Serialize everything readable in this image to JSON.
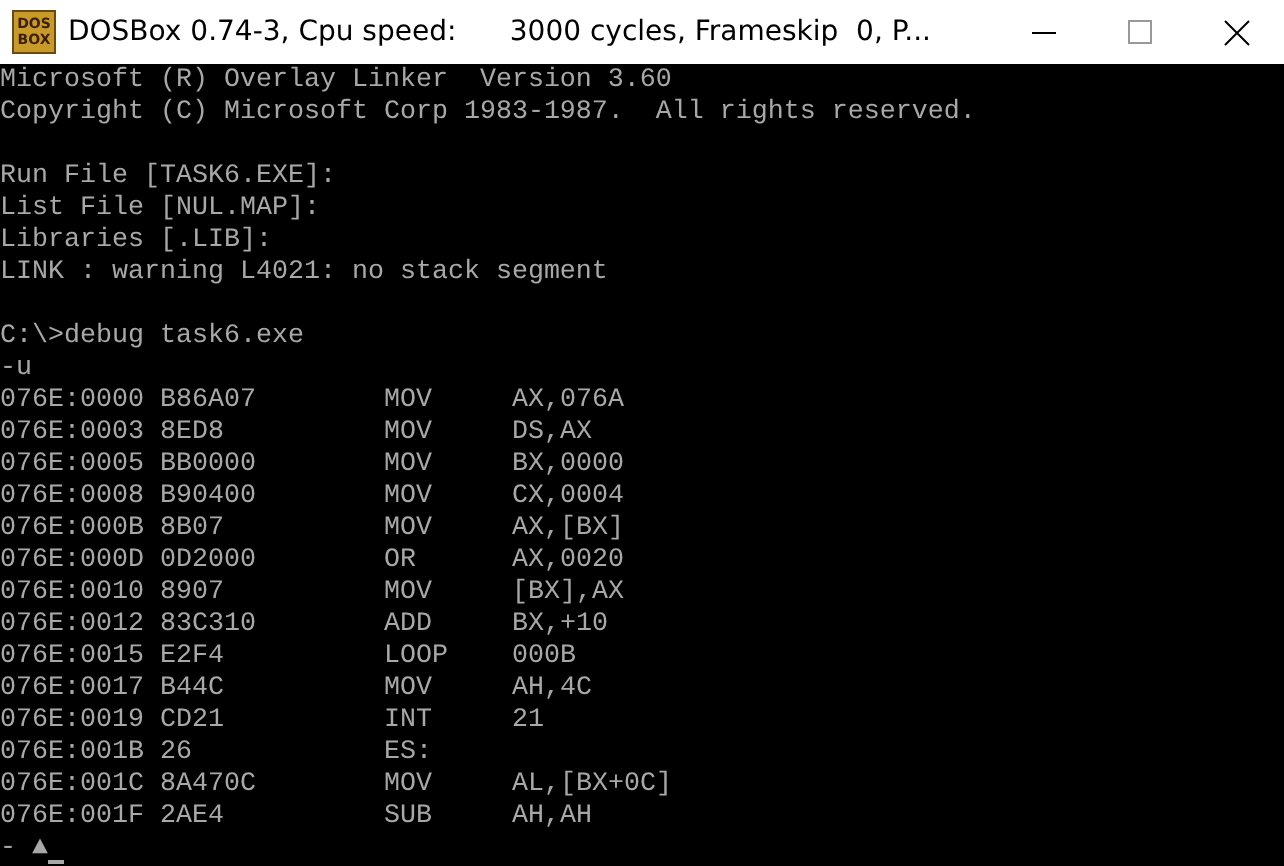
{
  "window": {
    "title": "DOSBox 0.74-3, Cpu speed:      3000 cycles, Frameskip  0, P...",
    "icon_text": [
      "DOS",
      "BOX"
    ]
  },
  "console": {
    "blocks": [
      {
        "lines": [
          "Microsoft (R) Overlay Linker  Version 3.60",
          "Copyright (C) Microsoft Corp 1983-1987.  All rights reserved."
        ]
      },
      {
        "lines": [
          "Run File [TASK6.EXE]:",
          "List File [NUL.MAP]:",
          "Libraries [.LIB]:",
          "LINK : warning L4021: no stack segment"
        ]
      },
      {
        "lines": [
          "C:\\>debug task6.exe",
          "-u"
        ]
      }
    ],
    "disassembly": [
      {
        "address": "076E:0000",
        "bytes": "B86A07",
        "mnemonic": "MOV",
        "operands": "AX,076A"
      },
      {
        "address": "076E:0003",
        "bytes": "8ED8",
        "mnemonic": "MOV",
        "operands": "DS,AX"
      },
      {
        "address": "076E:0005",
        "bytes": "BB0000",
        "mnemonic": "MOV",
        "operands": "BX,0000"
      },
      {
        "address": "076E:0008",
        "bytes": "B90400",
        "mnemonic": "MOV",
        "operands": "CX,0004"
      },
      {
        "address": "076E:000B",
        "bytes": "8B07",
        "mnemonic": "MOV",
        "operands": "AX,[BX]"
      },
      {
        "address": "076E:000D",
        "bytes": "0D2000",
        "mnemonic": "OR",
        "operands": "AX,0020"
      },
      {
        "address": "076E:0010",
        "bytes": "8907",
        "mnemonic": "MOV",
        "operands": "[BX],AX"
      },
      {
        "address": "076E:0012",
        "bytes": "83C310",
        "mnemonic": "ADD",
        "operands": "BX,+10"
      },
      {
        "address": "076E:0015",
        "bytes": "E2F4",
        "mnemonic": "LOOP",
        "operands": "000B"
      },
      {
        "address": "076E:0017",
        "bytes": "B44C",
        "mnemonic": "MOV",
        "operands": "AH,4C"
      },
      {
        "address": "076E:0019",
        "bytes": "CD21",
        "mnemonic": "INT",
        "operands": "21"
      },
      {
        "address": "076E:001B",
        "bytes": "26",
        "mnemonic": "ES:"
      },
      {
        "address": "076E:001C",
        "bytes": "8A470C",
        "mnemonic": "MOV",
        "operands": "AL,[BX+0C]"
      },
      {
        "address": "076E:001F",
        "bytes": "2AE4",
        "mnemonic": "SUB",
        "operands": "AH,AH"
      }
    ],
    "prompt": "- ▲"
  }
}
